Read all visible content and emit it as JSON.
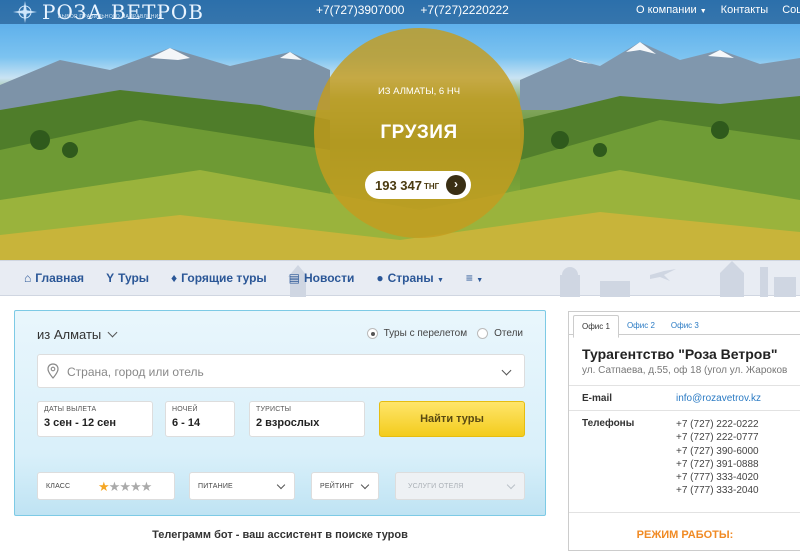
{
  "header": {
    "logo_title": "РОЗА ВЕТРОВ",
    "logo_subtitle": "ВЫБОР ПРАВИЛЬНОГО НАПРАВЛЕНИЯ",
    "phones": [
      "+7(727)3907000",
      "+7(727)2220222"
    ],
    "nav": [
      {
        "label": "О компании",
        "has_dropdown": true
      },
      {
        "label": "Контакты",
        "has_dropdown": false
      },
      {
        "label": "Соц",
        "has_dropdown": false
      }
    ]
  },
  "hero": {
    "departure": "ИЗ АЛМАТЫ, 6 НЧ",
    "country": "ГРУЗИЯ",
    "price": "193 347",
    "currency": "ТНГ",
    "go_icon": "chevron-right-icon"
  },
  "menu": [
    {
      "icon": "home-icon",
      "glyph": "⌂",
      "label": "Главная"
    },
    {
      "icon": "tours-icon",
      "glyph": "Y",
      "label": "Туры"
    },
    {
      "icon": "fire-icon",
      "glyph": "♦",
      "label": "Горящие туры"
    },
    {
      "icon": "news-icon",
      "glyph": "▤",
      "label": "Новости"
    },
    {
      "icon": "globe-icon",
      "glyph": "●",
      "label": "Страны"
    },
    {
      "icon": "menu-icon",
      "glyph": "≡",
      "label": ""
    }
  ],
  "search": {
    "from": "из Алматы",
    "radio_flight": "Туры с перелетом",
    "radio_hotels": "Отели",
    "destination_placeholder": "Страна, город или отель",
    "dates_label": "ДАТЫ ВЫЛЕТА",
    "dates_value": "3 сен - 12 сен",
    "nights_label": "НОЧЕЙ",
    "nights_value": "6 - 14",
    "tourists_label": "ТУРИСТЫ",
    "tourists_value": "2 взрослых",
    "find_button": "Найти туры",
    "class_label": "КЛАСС",
    "class_stars_selected": 1,
    "class_stars_total": 5,
    "meal_label": "ПИТАНИЕ",
    "rating_label": "РЕЙТИНГ",
    "services_label": "УСЛУГИ ОТЕЛЯ"
  },
  "telegram_text": "Телеграмм бот - ваш ассистент в поиске туров",
  "office": {
    "tabs": [
      "Офис 1",
      "Офис 2",
      "Офис 3"
    ],
    "active_tab": 0,
    "agency": "Турагентство \"Роза Ветров\"",
    "address": "ул. Сатпаева, д.55, оф 18 (угол ул. Жароков",
    "email_label": "E-mail",
    "email": "info@rozavetrov.kz",
    "phones_label": "Телефоны",
    "phones": [
      "+7 (727) 222-0222",
      "+7 (727) 222-0777",
      "+7 (727) 390-6000",
      "+7 (727) 391-0888",
      "+7 (777) 333-4020",
      "+7 (777) 333-2040"
    ],
    "hours_label": "РЕЖИМ РАБОТЫ:"
  },
  "colors": {
    "link_blue": "#2b5797",
    "gold_circle": "#c49c1e",
    "button_yellow": "#f3cc1d",
    "orange": "#f08a24"
  }
}
